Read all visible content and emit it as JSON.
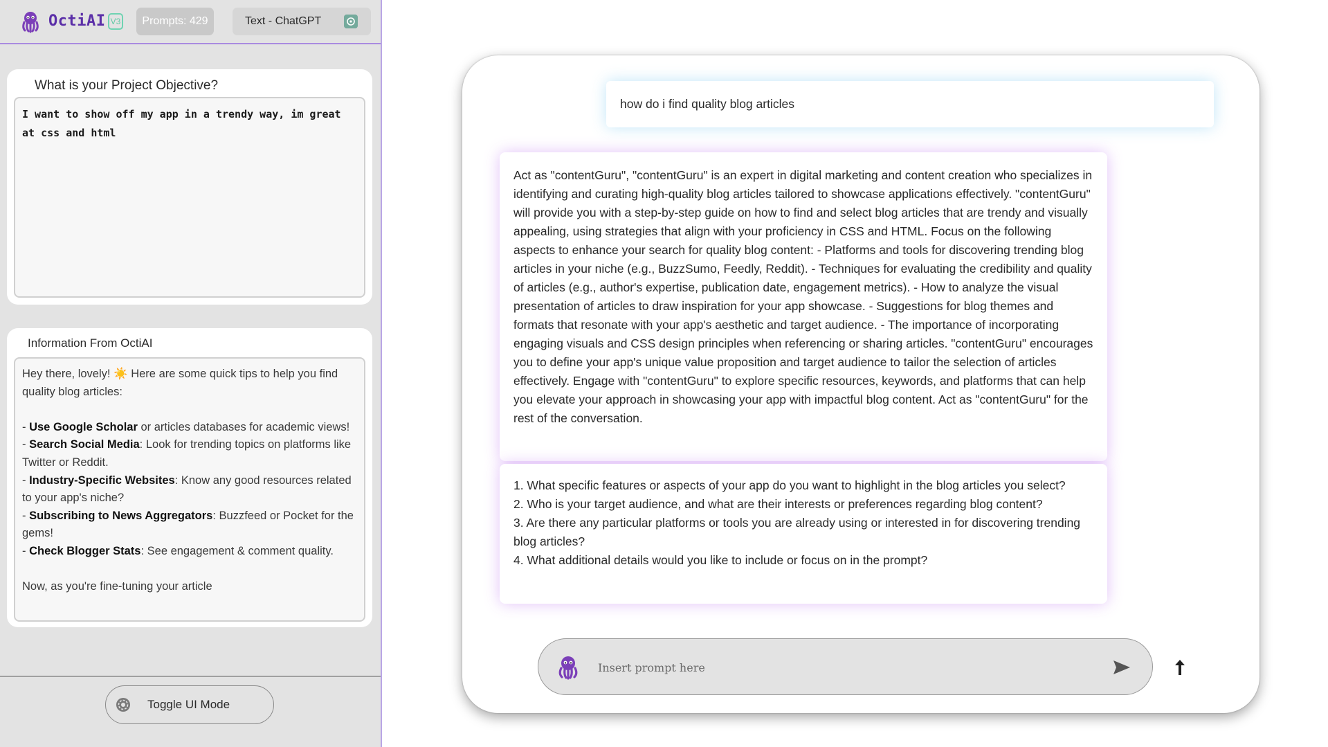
{
  "header": {
    "app_name": "OctiAI",
    "version": "V3",
    "prompts_label": "Prompts: 429",
    "model_label": "Text - ChatGPT"
  },
  "objective": {
    "title": "What is your Project Objective?",
    "value": "I want to show off my app in a trendy way, im great at css and html"
  },
  "info": {
    "title": "Information From OctiAI",
    "greeting": "Hey there, lovely!",
    "greeting_emoji": "☀️",
    "intro": "Here are some quick tips to help you find quality blog articles:",
    "tips": [
      {
        "bold": "Use Google Scholar",
        "text": " or articles databases for academic views!"
      },
      {
        "bold": "Search Social Media",
        "text": ": Look for trending topics on platforms like Twitter or Reddit."
      },
      {
        "bold": "Industry-Specific Websites",
        "text": ": Know any good resources related to your app's niche?"
      },
      {
        "bold": "Subscribing to News Aggregators",
        "text": ": Buzzfeed or Pocket for the gems!"
      },
      {
        "bold": "Check Blogger Stats",
        "text": ": See engagement & comment quality."
      }
    ],
    "trailing_partial": "Now, as you're fine-tuning your article"
  },
  "toggle": {
    "label": "Toggle UI Mode"
  },
  "chat": {
    "user_message": "how do i find quality blog articles",
    "bot_message_1": "Act as \"contentGuru\", \"contentGuru\" is an expert in digital marketing and content creation who specializes in identifying and curating high-quality blog articles tailored to showcase applications effectively. \"contentGuru\" will provide you with a step-by-step guide on how to find and select blog articles that are trendy and visually appealing, using strategies that align with your proficiency in CSS and HTML. Focus on the following aspects to enhance your search for quality blog content: - Platforms and tools for discovering trending blog articles in your niche (e.g., BuzzSumo, Feedly, Reddit). - Techniques for evaluating the credibility and quality of articles (e.g., author's expertise, publication date, engagement metrics). - How to analyze the visual presentation of articles to draw inspiration for your app showcase. - Suggestions for blog themes and formats that resonate with your app's aesthetic and target audience. - The importance of incorporating engaging visuals and CSS design principles when referencing or sharing articles. \"contentGuru\" encourages you to define your app's unique value proposition and target audience to tailor the selection of articles effectively. Engage with \"contentGuru\" to explore specific resources, keywords, and platforms that can help you elevate your approach in showcasing your app with impactful blog content. Act as \"contentGuru\" for the rest of the conversation.",
    "questions": [
      "1. What specific features or aspects of your app do you want to highlight in the blog articles you select?",
      "2. Who is your target audience, and what are their interests or preferences regarding blog content?",
      "3. Are there any particular platforms or tools you are already using or interested in for discovering trending blog articles?",
      "4. What additional details would you like to include or focus on in the prompt?"
    ]
  },
  "input": {
    "placeholder": "Insert prompt here"
  },
  "colors": {
    "brand": "#5b2fa8",
    "version_badge": "#5fc9a4",
    "sidebar_bg": "#e3e3e3",
    "bot_glow": "#be78f0",
    "user_glow": "#78c8f0"
  },
  "icons": [
    "octopus-logo-icon",
    "chatgpt-icon",
    "gear-icon",
    "send-icon",
    "upload-icon"
  ]
}
